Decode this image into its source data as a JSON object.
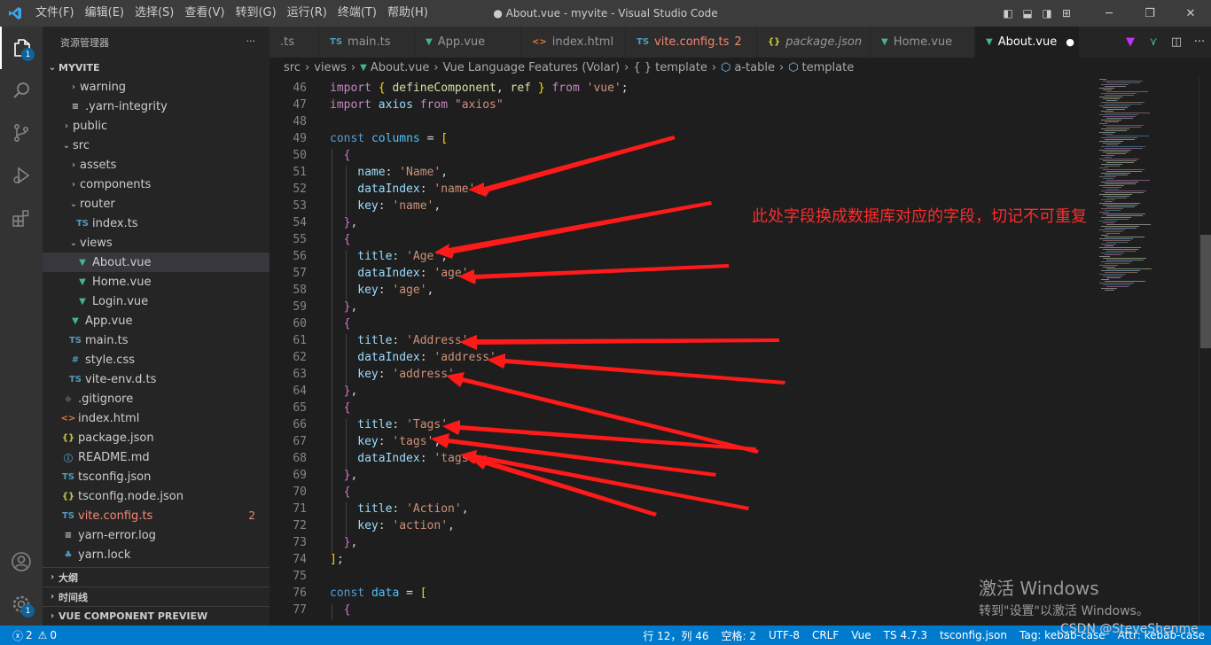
{
  "window": {
    "title": "● About.vue - myvite - Visual Studio Code",
    "menu": [
      "文件(F)",
      "编辑(E)",
      "选择(S)",
      "查看(V)",
      "转到(G)",
      "运行(R)",
      "终端(T)",
      "帮助(H)"
    ]
  },
  "activity": {
    "explorer_badge": "1",
    "settings_badge": "1"
  },
  "sidebar": {
    "title": "资源管理器",
    "more": "···",
    "root": "MYVITE",
    "tree": [
      {
        "name": "warning",
        "icon": "chevron-right",
        "indent": 1,
        "kind": "folder"
      },
      {
        "name": ".yarn-integrity",
        "icon": "lines",
        "indent": 1,
        "kind": "file"
      },
      {
        "name": "public",
        "icon": "chevron-right",
        "indent": 0,
        "kind": "folder"
      },
      {
        "name": "src",
        "icon": "chevron-down",
        "indent": 0,
        "kind": "folder"
      },
      {
        "name": "assets",
        "icon": "chevron-right",
        "indent": 1,
        "kind": "folder"
      },
      {
        "name": "components",
        "icon": "chevron-right",
        "indent": 1,
        "kind": "folder"
      },
      {
        "name": "router",
        "icon": "chevron-down",
        "indent": 1,
        "kind": "folder"
      },
      {
        "name": "index.ts",
        "icon": "ts",
        "indent": 2,
        "kind": "file"
      },
      {
        "name": "views",
        "icon": "chevron-down",
        "indent": 1,
        "kind": "folder"
      },
      {
        "name": "About.vue",
        "icon": "vue",
        "indent": 2,
        "kind": "file",
        "selected": true
      },
      {
        "name": "Home.vue",
        "icon": "vue",
        "indent": 2,
        "kind": "file"
      },
      {
        "name": "Login.vue",
        "icon": "vue",
        "indent": 2,
        "kind": "file"
      },
      {
        "name": "App.vue",
        "icon": "vue",
        "indent": 1,
        "kind": "file"
      },
      {
        "name": "main.ts",
        "icon": "ts",
        "indent": 1,
        "kind": "file"
      },
      {
        "name": "style.css",
        "icon": "css",
        "indent": 1,
        "kind": "file"
      },
      {
        "name": "vite-env.d.ts",
        "icon": "ts",
        "indent": 1,
        "kind": "file"
      },
      {
        "name": ".gitignore",
        "icon": "git",
        "indent": 0,
        "kind": "file"
      },
      {
        "name": "index.html",
        "icon": "html",
        "indent": 0,
        "kind": "file"
      },
      {
        "name": "package.json",
        "icon": "json",
        "indent": 0,
        "kind": "file"
      },
      {
        "name": "README.md",
        "icon": "info",
        "indent": 0,
        "kind": "file"
      },
      {
        "name": "tsconfig.json",
        "icon": "tsconfig",
        "indent": 0,
        "kind": "file"
      },
      {
        "name": "tsconfig.node.json",
        "icon": "json",
        "indent": 0,
        "kind": "file"
      },
      {
        "name": "vite.config.ts",
        "icon": "ts",
        "indent": 0,
        "kind": "file",
        "error": true,
        "count": "2"
      },
      {
        "name": "yarn-error.log",
        "icon": "lines",
        "indent": 0,
        "kind": "file"
      },
      {
        "name": "yarn.lock",
        "icon": "yarn",
        "indent": 0,
        "kind": "file"
      }
    ],
    "sections": [
      "大纲",
      "时间线",
      "VUE COMPONENT PREVIEW"
    ]
  },
  "tabs": [
    {
      "label": ".ts",
      "icon": ""
    },
    {
      "label": "main.ts",
      "icon": "TS"
    },
    {
      "label": "App.vue",
      "icon": "V"
    },
    {
      "label": "index.html",
      "icon": "<>"
    },
    {
      "label": "vite.config.ts",
      "icon": "TS",
      "error": true,
      "count": "2"
    },
    {
      "label": "package.json",
      "icon": "{}",
      "italic": true
    },
    {
      "label": "Home.vue",
      "icon": "V"
    },
    {
      "label": "About.vue",
      "icon": "V",
      "active": true,
      "dirty": true
    }
  ],
  "breadcrumb": [
    "src",
    "views",
    "About.vue",
    "Vue Language Features (Volar)",
    "{ } template",
    "a-table",
    "template"
  ],
  "editor": {
    "lines": [
      {
        "n": "46",
        "ind": 0,
        "tokens": [
          [
            "kc",
            "import"
          ],
          [
            "pun",
            " "
          ],
          [
            "br1",
            "{"
          ],
          [
            "pun",
            " "
          ],
          [
            "fn",
            "defineComponent"
          ],
          [
            "pun",
            ", "
          ],
          [
            "fn",
            "ref"
          ],
          [
            "pun",
            " "
          ],
          [
            "br1",
            "}"
          ],
          [
            "pun",
            " "
          ],
          [
            "kc",
            "from"
          ],
          [
            "pun",
            " "
          ],
          [
            "str",
            "'vue'"
          ],
          [
            "pun",
            ";"
          ]
        ]
      },
      {
        "n": "47",
        "ind": 0,
        "tokens": [
          [
            "kc",
            "import"
          ],
          [
            "pun",
            " "
          ],
          [
            "prop",
            "axios"
          ],
          [
            "pun",
            " "
          ],
          [
            "kc",
            "from"
          ],
          [
            "pun",
            " "
          ],
          [
            "str",
            "\"axios\""
          ]
        ]
      },
      {
        "n": "48",
        "ind": 0,
        "tokens": []
      },
      {
        "n": "49",
        "ind": 0,
        "tokens": [
          [
            "kw",
            "const"
          ],
          [
            "pun",
            " "
          ],
          [
            "var",
            "columns"
          ],
          [
            "pun",
            " = "
          ],
          [
            "br1",
            "["
          ]
        ]
      },
      {
        "n": "50",
        "ind": 1,
        "tokens": [
          [
            "br2",
            "{"
          ]
        ]
      },
      {
        "n": "51",
        "ind": 2,
        "tokens": [
          [
            "prop",
            "name"
          ],
          [
            "pun",
            ": "
          ],
          [
            "str",
            "'Name'"
          ],
          [
            "pun",
            ","
          ]
        ]
      },
      {
        "n": "52",
        "ind": 2,
        "tokens": [
          [
            "prop",
            "dataIndex"
          ],
          [
            "pun",
            ": "
          ],
          [
            "str",
            "'name'"
          ],
          [
            "pun",
            ","
          ]
        ]
      },
      {
        "n": "53",
        "ind": 2,
        "tokens": [
          [
            "prop",
            "key"
          ],
          [
            "pun",
            ": "
          ],
          [
            "str",
            "'name'"
          ],
          [
            "pun",
            ","
          ]
        ]
      },
      {
        "n": "54",
        "ind": 1,
        "tokens": [
          [
            "br2",
            "}"
          ],
          [
            "pun",
            ","
          ]
        ]
      },
      {
        "n": "55",
        "ind": 1,
        "tokens": [
          [
            "br2",
            "{"
          ]
        ]
      },
      {
        "n": "56",
        "ind": 2,
        "tokens": [
          [
            "prop",
            "title"
          ],
          [
            "pun",
            ": "
          ],
          [
            "str",
            "'Age'"
          ],
          [
            "pun",
            ","
          ]
        ]
      },
      {
        "n": "57",
        "ind": 2,
        "tokens": [
          [
            "prop",
            "dataIndex"
          ],
          [
            "pun",
            ": "
          ],
          [
            "str",
            "'age'"
          ],
          [
            "pun",
            ","
          ]
        ]
      },
      {
        "n": "58",
        "ind": 2,
        "tokens": [
          [
            "prop",
            "key"
          ],
          [
            "pun",
            ": "
          ],
          [
            "str",
            "'age'"
          ],
          [
            "pun",
            ","
          ]
        ]
      },
      {
        "n": "59",
        "ind": 1,
        "tokens": [
          [
            "br2",
            "}"
          ],
          [
            "pun",
            ","
          ]
        ]
      },
      {
        "n": "60",
        "ind": 1,
        "tokens": [
          [
            "br2",
            "{"
          ]
        ]
      },
      {
        "n": "61",
        "ind": 2,
        "tokens": [
          [
            "prop",
            "title"
          ],
          [
            "pun",
            ": "
          ],
          [
            "str",
            "'Address'"
          ],
          [
            "pun",
            ","
          ]
        ]
      },
      {
        "n": "62",
        "ind": 2,
        "tokens": [
          [
            "prop",
            "dataIndex"
          ],
          [
            "pun",
            ": "
          ],
          [
            "str",
            "'address'"
          ],
          [
            "pun",
            ","
          ]
        ]
      },
      {
        "n": "63",
        "ind": 2,
        "tokens": [
          [
            "prop",
            "key"
          ],
          [
            "pun",
            ": "
          ],
          [
            "str",
            "'address'"
          ],
          [
            "pun",
            ","
          ]
        ]
      },
      {
        "n": "64",
        "ind": 1,
        "tokens": [
          [
            "br2",
            "}"
          ],
          [
            "pun",
            ","
          ]
        ]
      },
      {
        "n": "65",
        "ind": 1,
        "tokens": [
          [
            "br2",
            "{"
          ]
        ]
      },
      {
        "n": "66",
        "ind": 2,
        "tokens": [
          [
            "prop",
            "title"
          ],
          [
            "pun",
            ": "
          ],
          [
            "str",
            "'Tags'"
          ],
          [
            "pun",
            ","
          ]
        ]
      },
      {
        "n": "67",
        "ind": 2,
        "tokens": [
          [
            "prop",
            "key"
          ],
          [
            "pun",
            ": "
          ],
          [
            "str",
            "'tags'"
          ],
          [
            "pun",
            ","
          ]
        ]
      },
      {
        "n": "68",
        "ind": 2,
        "tokens": [
          [
            "prop",
            "dataIndex"
          ],
          [
            "pun",
            ": "
          ],
          [
            "str",
            "'tags'"
          ],
          [
            "pun",
            ","
          ]
        ]
      },
      {
        "n": "69",
        "ind": 1,
        "tokens": [
          [
            "br2",
            "}"
          ],
          [
            "pun",
            ","
          ]
        ]
      },
      {
        "n": "70",
        "ind": 1,
        "tokens": [
          [
            "br2",
            "{"
          ]
        ]
      },
      {
        "n": "71",
        "ind": 2,
        "tokens": [
          [
            "prop",
            "title"
          ],
          [
            "pun",
            ": "
          ],
          [
            "str",
            "'Action'"
          ],
          [
            "pun",
            ","
          ]
        ]
      },
      {
        "n": "72",
        "ind": 2,
        "tokens": [
          [
            "prop",
            "key"
          ],
          [
            "pun",
            ": "
          ],
          [
            "str",
            "'action'"
          ],
          [
            "pun",
            ","
          ]
        ]
      },
      {
        "n": "73",
        "ind": 1,
        "tokens": [
          [
            "br2",
            "}"
          ],
          [
            "pun",
            ","
          ]
        ]
      },
      {
        "n": "74",
        "ind": 0,
        "tokens": [
          [
            "br1",
            "]"
          ],
          [
            "pun",
            ";"
          ]
        ]
      },
      {
        "n": "75",
        "ind": 0,
        "tokens": []
      },
      {
        "n": "76",
        "ind": 0,
        "tokens": [
          [
            "kw",
            "const"
          ],
          [
            "pun",
            " "
          ],
          [
            "var",
            "data"
          ],
          [
            "pun",
            " = "
          ],
          [
            "br1",
            "["
          ]
        ]
      },
      {
        "n": "77",
        "ind": 1,
        "tokens": [
          [
            "br2",
            "{"
          ]
        ]
      }
    ]
  },
  "annotation": "此处字段换成数据库对应的字段，切记不可重复",
  "watermark": {
    "line1": "激活 Windows",
    "line2": "转到\"设置\"以激活 Windows。",
    "csdn": "CSDN @SteveShenme"
  },
  "statusbar": {
    "errors": "2",
    "warnings": "0",
    "items": [
      "行 12，列 46",
      "空格: 2",
      "UTF-8",
      "CRLF",
      "Vue",
      "TS 4.7.3",
      "tsconfig.json",
      "Tag: kebab-case",
      "Attr: kebab-case"
    ]
  },
  "colors": {
    "accent": "#007acc",
    "annotation_red": "#ff2b2b"
  }
}
